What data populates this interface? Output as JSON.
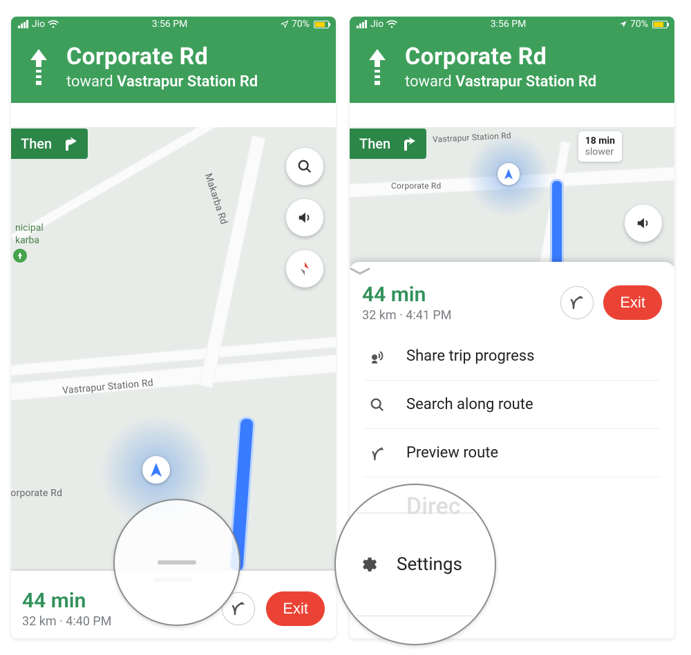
{
  "status": {
    "carrier": "Jio",
    "time": "3:56 PM",
    "battery": "70%"
  },
  "nav": {
    "road": "Corporate Rd",
    "toward_prefix": "toward ",
    "toward": "Vastrapur Station Rd",
    "then": "Then"
  },
  "map": {
    "labels": {
      "municipal": "nicipal",
      "makarba": "karba",
      "road_makarba": "Makarba Rd",
      "road_vastrapur": "Vastrapur Station Rd",
      "road_corporate": "Corporate Rd"
    },
    "slower": {
      "time": "18 min",
      "label": "slower"
    }
  },
  "eta_left": {
    "minutes": "44 min",
    "detail": "32 km · 4:40 PM"
  },
  "eta_right": {
    "minutes": "44 min",
    "detail": "32 km · 4:41 PM"
  },
  "buttons": {
    "exit": "Exit"
  },
  "sheet": {
    "share": "Share trip progress",
    "search": "Search along route",
    "preview": "Preview route",
    "directions_truncated": "Direc",
    "settings": "Settings"
  }
}
